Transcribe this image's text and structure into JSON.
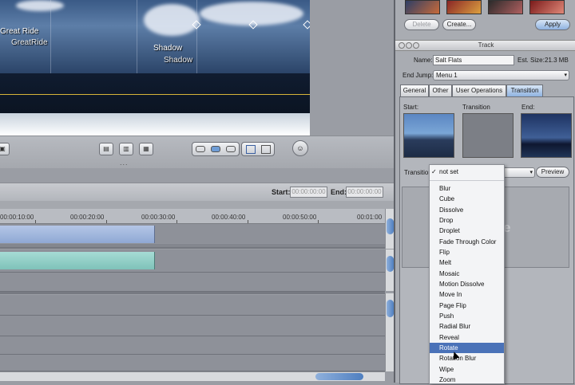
{
  "viewer": {
    "caption1_main": "Great Ride",
    "caption1_sub": "GreatRide",
    "caption2_main": "Shadow",
    "caption2_sub": "Shadow"
  },
  "toolbar": {
    "more_dots": "..."
  },
  "range": {
    "start_label": "Start:",
    "start_value": "00:00:00:00",
    "end_label": "End:",
    "end_value": "00:00:00:00"
  },
  "ruler": {
    "marks": [
      "00:00:10:00",
      "00:00:20:00",
      "00:00:30:00",
      "00:00:40:00",
      "00:00:50:00",
      "00:01:00"
    ]
  },
  "panel": {
    "delete_label": "Delete",
    "create_label": "Create...",
    "apply_label": "Apply",
    "window_title": "Track",
    "name_label": "Name:",
    "name_value": "Salt Flats",
    "size_label": "Est. Size:",
    "size_value": "21.3 MB",
    "endjump_label": "End Jump:",
    "endjump_value": "Menu 1",
    "tabs": [
      "General",
      "Other",
      "User Operations",
      "Transition"
    ],
    "start_label": "Start:",
    "transition_label": "Transition",
    "end_label": "End:",
    "transition_field_label": "Transition",
    "preview_label": "Preview",
    "watermark": "cable"
  },
  "menu": {
    "selected": "not set",
    "items": [
      "Blur",
      "Cube",
      "Dissolve",
      "Drop",
      "Droplet",
      "Fade Through Color",
      "Flip",
      "Melt",
      "Mosaic",
      "Motion Dissolve",
      "Move In",
      "Page Flip",
      "Push",
      "Radial Blur",
      "Reveal",
      "Rotate",
      "Rotation Blur",
      "Wipe",
      "Zoom"
    ],
    "highlighted": "Rotate"
  },
  "colors": {
    "highlight": "#4a72b8",
    "clip_blue": "#9fb6de",
    "clip_teal": "#8fcdc5",
    "guide_line": "#d8b43a"
  }
}
